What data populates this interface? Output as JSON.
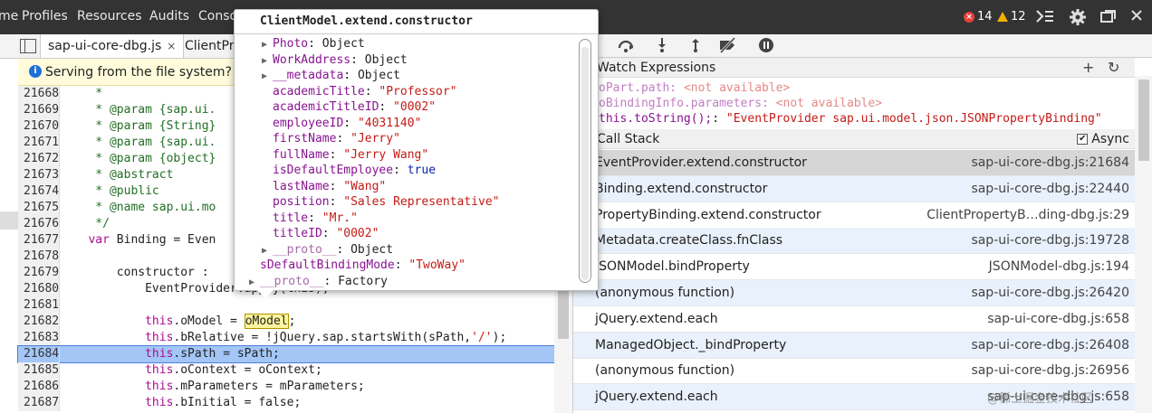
{
  "topbar": {
    "tabs": [
      "me",
      "Profiles",
      "Resources",
      "Audits",
      "Conso"
    ],
    "errors": "14",
    "warnings": "12"
  },
  "editor": {
    "tabs": [
      {
        "label": "sap-ui-core-dbg.js",
        "close": "×"
      },
      {
        "label": "ClientPro"
      }
    ],
    "info": "Serving from the file system? Ad",
    "lines": [
      {
        "num": "21668",
        "segs": [
          {
            "t": "    *",
            "c": "com"
          }
        ]
      },
      {
        "num": "21669",
        "segs": [
          {
            "t": "    * @param {sap.ui.",
            "c": "com"
          }
        ]
      },
      {
        "num": "21670",
        "segs": [
          {
            "t": "    * @param {String}",
            "c": "com"
          }
        ]
      },
      {
        "num": "21671",
        "segs": [
          {
            "t": "    * @param {sap.ui.",
            "c": "com"
          }
        ]
      },
      {
        "num": "21672",
        "segs": [
          {
            "t": "    * @param {object}",
            "c": "com"
          }
        ]
      },
      {
        "num": "21673",
        "segs": [
          {
            "t": "    * @abstract",
            "c": "com"
          }
        ]
      },
      {
        "num": "21674",
        "segs": [
          {
            "t": "    * @public",
            "c": "com"
          }
        ]
      },
      {
        "num": "21675",
        "segs": [
          {
            "t": "    * @name sap.ui.mo",
            "c": "com"
          }
        ]
      },
      {
        "num": "21676",
        "segs": [
          {
            "t": "    */",
            "c": "com"
          }
        ]
      },
      {
        "num": "21677",
        "segs": [
          {
            "t": "   ",
            "c": ""
          },
          {
            "t": "var",
            "c": "kw"
          },
          {
            "t": " Binding = Even",
            "c": ""
          }
        ]
      },
      {
        "num": "21678",
        "segs": [
          {
            "t": "",
            "c": ""
          }
        ]
      },
      {
        "num": "21679",
        "segs": [
          {
            "t": "       constructor : ",
            "c": ""
          }
        ]
      },
      {
        "num": "21680",
        "segs": [
          {
            "t": "           EventProvider.apply(this);",
            "c": ""
          }
        ]
      },
      {
        "num": "21681",
        "segs": [
          {
            "t": "",
            "c": ""
          }
        ]
      },
      {
        "num": "21682",
        "segs": [
          {
            "t": "           ",
            "c": ""
          },
          {
            "t": "this",
            "c": "kw"
          },
          {
            "t": ".oModel = ",
            "c": ""
          },
          {
            "t": "oModel",
            "c": "box"
          },
          {
            "t": ";",
            "c": ""
          }
        ]
      },
      {
        "num": "21683",
        "segs": [
          {
            "t": "           ",
            "c": ""
          },
          {
            "t": "this",
            "c": "kw"
          },
          {
            "t": ".bRelative = !jQuery.sap.startsWith(sPath,",
            "c": ""
          },
          {
            "t": "'/'",
            "c": "str"
          },
          {
            "t": ");",
            "c": ""
          }
        ]
      },
      {
        "num": "21684",
        "hl": true,
        "segs": [
          {
            "t": "           ",
            "c": ""
          },
          {
            "t": "this",
            "c": "kw"
          },
          {
            "t": ".sPath = sPath;",
            "c": ""
          }
        ]
      },
      {
        "num": "21685",
        "segs": [
          {
            "t": "           ",
            "c": ""
          },
          {
            "t": "this",
            "c": "kw"
          },
          {
            "t": ".oContext = oContext;",
            "c": ""
          }
        ]
      },
      {
        "num": "21686",
        "segs": [
          {
            "t": "           ",
            "c": ""
          },
          {
            "t": "this",
            "c": "kw"
          },
          {
            "t": ".mParameters = mParameters;",
            "c": ""
          }
        ]
      },
      {
        "num": "21687",
        "segs": [
          {
            "t": "           ",
            "c": ""
          },
          {
            "t": "this",
            "c": "kw"
          },
          {
            "t": ".bInitial = false;",
            "c": ""
          }
        ]
      }
    ]
  },
  "popover": {
    "title": "ClientModel.extend.constructor",
    "rows": [
      {
        "key": "Photo",
        "val": "Object",
        "vt": "o",
        "tri": true,
        "indent": 1
      },
      {
        "key": "WorkAddress",
        "val": "Object",
        "vt": "o",
        "tri": true,
        "indent": 1
      },
      {
        "key": "__metadata",
        "val": "Object",
        "vt": "o",
        "tri": true,
        "indent": 1
      },
      {
        "key": "academicTitle",
        "val": "\"Professor\"",
        "vt": "s",
        "indent": 1
      },
      {
        "key": "academicTitleID",
        "val": "\"0002\"",
        "vt": "s",
        "indent": 1
      },
      {
        "key": "employeeID",
        "val": "\"4031140\"",
        "vt": "s",
        "indent": 1
      },
      {
        "key": "firstName",
        "val": "\"Jerry\"",
        "vt": "s",
        "indent": 1
      },
      {
        "key": "fullName",
        "val": "\"Jerry Wang\"",
        "vt": "s",
        "indent": 1
      },
      {
        "key": "isDefaultEmployee",
        "val": "true",
        "vt": "b",
        "indent": 1
      },
      {
        "key": "lastName",
        "val": "\"Wang\"",
        "vt": "s",
        "indent": 1
      },
      {
        "key": "position",
        "val": "\"Sales Representative\"",
        "vt": "s",
        "indent": 1
      },
      {
        "key": "title",
        "val": "\"Mr.\"",
        "vt": "s",
        "indent": 1
      },
      {
        "key": "titleID",
        "val": "\"0002\"",
        "vt": "s",
        "indent": 1
      },
      {
        "key": "__proto__",
        "val": "Object",
        "vt": "o",
        "tri": true,
        "indent": 1,
        "dim": true
      },
      {
        "key": "sDefaultBindingMode",
        "val": "\"TwoWay\"",
        "vt": "s",
        "indent": 0
      },
      {
        "key": "__proto__",
        "val": "Factory",
        "vt": "o",
        "tri": true,
        "indent": 0,
        "dim": true
      }
    ]
  },
  "watch": {
    "title": "Watch Expressions",
    "add": "+",
    "refresh": "↻",
    "items": [
      {
        "expr": "oPart.path",
        "val": "<not available>",
        "vt": "na"
      },
      {
        "expr": "oBindingInfo.parameters",
        "val": "<not available>",
        "vt": "na"
      },
      {
        "expr": "this.toString();",
        "val": "\"EventProvider sap.ui.model.json.JSONPropertyBinding\"",
        "vt": "s"
      }
    ]
  },
  "callstack": {
    "title": "Call Stack",
    "async_label": "Async",
    "async_checked": "✔",
    "frames": [
      {
        "fn": "EventProvider.extend.constructor",
        "loc": "sap-ui-core-dbg.js:21684",
        "sel": true
      },
      {
        "fn": "Binding.extend.constructor",
        "loc": "sap-ui-core-dbg.js:22440"
      },
      {
        "fn": "PropertyBinding.extend.constructor",
        "loc": "ClientPropertyB…ding-dbg.js:29"
      },
      {
        "fn": "Metadata.createClass.fnClass",
        "loc": "sap-ui-core-dbg.js:19728"
      },
      {
        "fn": "JSONModel.bindProperty",
        "loc": "JSONModel-dbg.js:194"
      },
      {
        "fn": "(anonymous function)",
        "loc": "sap-ui-core-dbg.js:26420"
      },
      {
        "fn": "jQuery.extend.each",
        "loc": "sap-ui-core-dbg.js:658"
      },
      {
        "fn": "ManagedObject._bindProperty",
        "loc": "sap-ui-core-dbg.js:26408"
      },
      {
        "fn": "(anonymous function)",
        "loc": "sap-ui-core-dbg.js:26956"
      },
      {
        "fn": "jQuery.extend.each",
        "loc": "sap-ui-core-dbg.js:658"
      }
    ]
  },
  "watermark": "@稀土掘金技术社区"
}
